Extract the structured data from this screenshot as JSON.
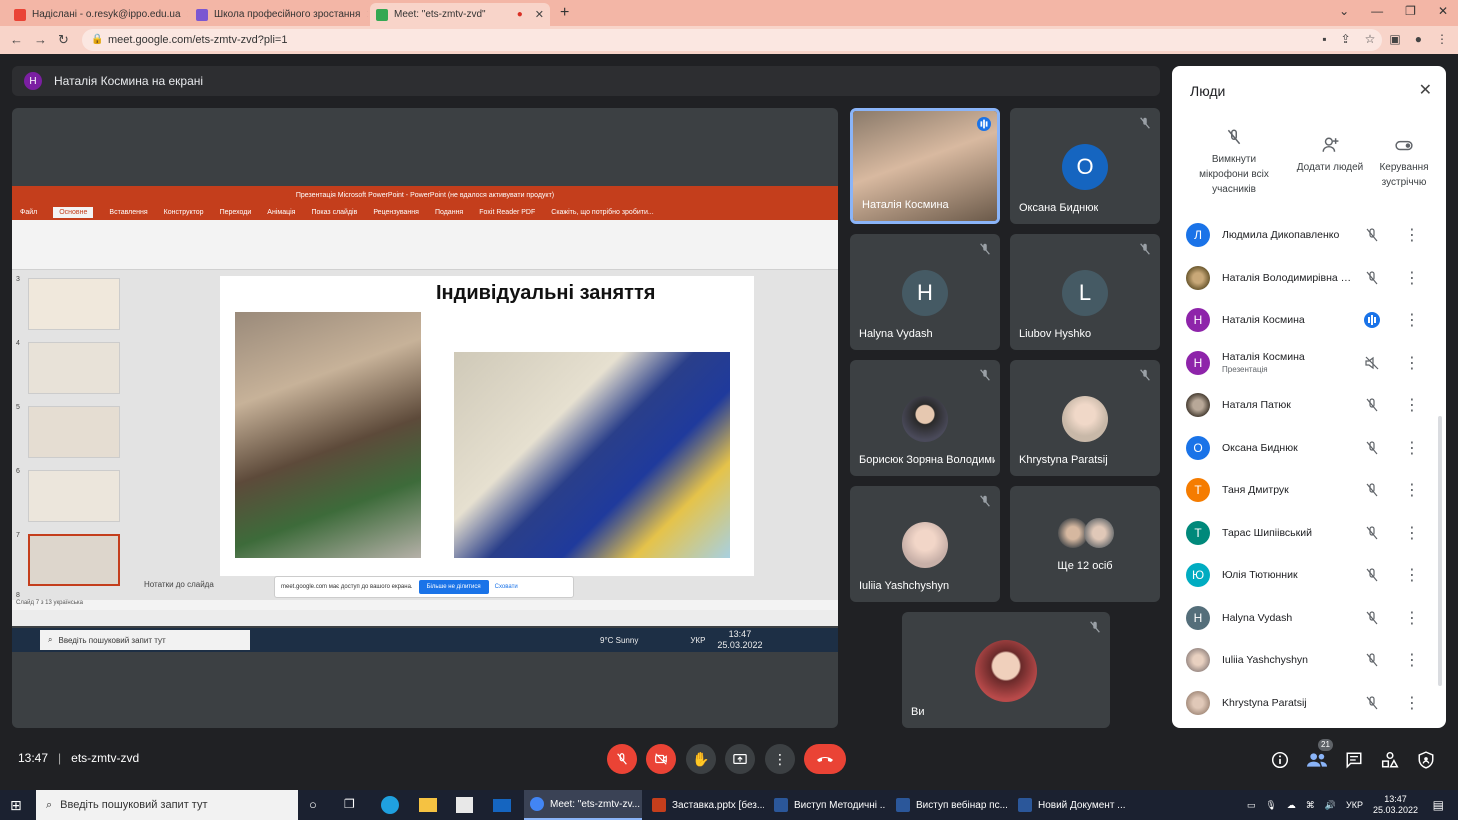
{
  "browser": {
    "tabs": [
      {
        "label": "Надіслані - o.resyk@ippo.edu.ua",
        "color": "#ea4335"
      },
      {
        "label": "Школа професійного зростання",
        "color": "#7b57d1"
      },
      {
        "label": "Meet: \"ets-zmtv-zvd\"",
        "color": "#34a853"
      }
    ],
    "url": "meet.google.com/ets-zmtv-zvd?pli=1"
  },
  "meet": {
    "presenting_label": "Наталія Космина на екрані",
    "presenter_initial": "Н",
    "time": "13:47",
    "code": "ets-zmtv-zvd",
    "participant_count": "21"
  },
  "slide": {
    "app_title": "Презентація Microsoft PowerPoint - PowerPoint (не вдалося активувати продукт)",
    "ribbon_tabs": [
      "Файл",
      "Основне",
      "Вставлення",
      "Конструктор",
      "Переходи",
      "Анімація",
      "Показ слайдів",
      "Рецензування",
      "Подання",
      "Foxit Reader PDF",
      "Скажіть, що потрібно зробити..."
    ],
    "title": "Індивідуальні заняття",
    "notes": "Нотатки до слайда",
    "status": "Слайд 7 з 13    українська",
    "thumb_numbers": [
      "3",
      "4",
      "5",
      "6",
      "7",
      "8"
    ],
    "toast_text": "meet.google.com має доступ до вашого екрана.",
    "toast_stop": "Більше не ділитися",
    "toast_hide": "Сховати",
    "taskbar_search": "Введіть пошуковий запит тут",
    "weather": "9°C  Sunny",
    "clock_time": "13:47",
    "clock_date": "25.03.2022",
    "lang": "УКР"
  },
  "tiles": [
    {
      "name": "Наталія Космина",
      "initial": "",
      "color": "#7b1fa2",
      "photo": true,
      "speaking": true
    },
    {
      "name": "Оксана Биднюк",
      "initial": "О",
      "color": "#1565c0"
    },
    {
      "name": "Halyna Vydash",
      "initial": "H",
      "color": "#455a64"
    },
    {
      "name": "Liubov Hyshko",
      "initial": "L",
      "color": "#455a64"
    },
    {
      "name": "Борисюк Зоряна Володимирівна",
      "initial": "",
      "color": "#3a3a3a",
      "photo": true
    },
    {
      "name": "Khrystyna Paratsij",
      "initial": "",
      "color": "#c8b8a8",
      "photo": true
    },
    {
      "name": "Iuliia Yashchyshyn",
      "initial": "",
      "color": "#c8b0a8",
      "photo": true
    },
    {
      "name": "Ще 12 осіб",
      "initial": "",
      "color": "#3c4043"
    },
    {
      "name": "Ви",
      "initial": "",
      "color": "#a83e3e",
      "photo": true
    }
  ],
  "people": {
    "title": "Люди",
    "actions": [
      {
        "label": "Вимкнути мікрофони всіх учасників"
      },
      {
        "label": "Додати людей"
      },
      {
        "label": "Керування зустріччю"
      }
    ],
    "list": [
      {
        "name": "Людмила Дикопавленко",
        "initial": "Л",
        "color": "#1a73e8",
        "sub": ""
      },
      {
        "name": "Наталія Володимирівна Кутасевич",
        "initial": "",
        "color": "#6d5a30",
        "sub": ""
      },
      {
        "name": "Наталія Космина",
        "initial": "Н",
        "color": "#8e24aa",
        "sub": "",
        "speaking": true
      },
      {
        "name": "Наталія Космина",
        "initial": "Н",
        "color": "#8e24aa",
        "sub": "Презентація"
      },
      {
        "name": "Наталя Патюк",
        "initial": "",
        "color": "#6e6355",
        "sub": ""
      },
      {
        "name": "Оксана Биднюк",
        "initial": "О",
        "color": "#1a73e8",
        "sub": ""
      },
      {
        "name": "Таня Дмитрук",
        "initial": "Т",
        "color": "#f57c00",
        "sub": ""
      },
      {
        "name": "Тарас Шипіівський",
        "initial": "Т",
        "color": "#00897b",
        "sub": ""
      },
      {
        "name": "Юлія Тютюнник",
        "initial": "Ю",
        "color": "#00acc1",
        "sub": ""
      },
      {
        "name": "Halyna Vydash",
        "initial": "H",
        "color": "#546e7a",
        "sub": ""
      },
      {
        "name": "Iuliia Yashchyshyn",
        "initial": "",
        "color": "#9e8e88",
        "sub": ""
      },
      {
        "name": "Khrystyna Paratsij",
        "initial": "",
        "color": "#a89080",
        "sub": ""
      }
    ]
  },
  "taskbar": {
    "search": "Введіть пошуковий запит тут",
    "apps": [
      {
        "label": "Meet: \"ets-zmtv-zv...",
        "color": "#4285f4"
      },
      {
        "label": "Заставка.pptx [без...",
        "color": "#c43e1c"
      },
      {
        "label": "Виступ Методичні ...",
        "color": "#2b579a"
      },
      {
        "label": "Виступ вебінар пс...",
        "color": "#2b579a"
      },
      {
        "label": "Новий Документ ...",
        "color": "#2b579a"
      }
    ],
    "lang": "УКР",
    "time": "13:47",
    "date": "25.03.2022"
  }
}
